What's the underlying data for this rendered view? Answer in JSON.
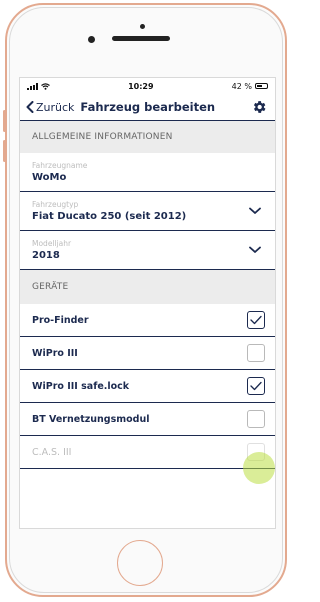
{
  "status_bar": {
    "time": "10:29",
    "battery": "42 %"
  },
  "navbar": {
    "back_label": "Zurück",
    "title": "Fahrzeug bearbeiten"
  },
  "sections": {
    "general": "ALLGEMEINE INFORMATIONEN",
    "devices": "GERÄTE"
  },
  "fields": [
    {
      "label": "Fahrzeugname",
      "value": "WoMo"
    },
    {
      "label": "Fahrzeugtyp",
      "value": "Fiat Ducato 250 (seit 2012)"
    },
    {
      "label": "Modelljahr",
      "value": "2018"
    }
  ],
  "devices": [
    {
      "name": "Pro-Finder",
      "checked": true,
      "disabled": false
    },
    {
      "name": "WiPro III",
      "checked": false,
      "disabled": false
    },
    {
      "name": "WiPro III safe.lock",
      "checked": true,
      "disabled": false
    },
    {
      "name": "BT Vernetzungsmodul",
      "checked": false,
      "disabled": false
    },
    {
      "name": "C.A.S. III",
      "checked": false,
      "disabled": true
    }
  ],
  "icons": {
    "back": "chevron-left-icon",
    "settings": "gear-icon",
    "dropdown": "chevron-down-icon",
    "check": "checkmark-icon"
  },
  "colors": {
    "primary": "#1c2a4f",
    "section_bg": "#ececec",
    "phone_frame": "#e3a98f",
    "touch_indicator": "#bbde44"
  }
}
